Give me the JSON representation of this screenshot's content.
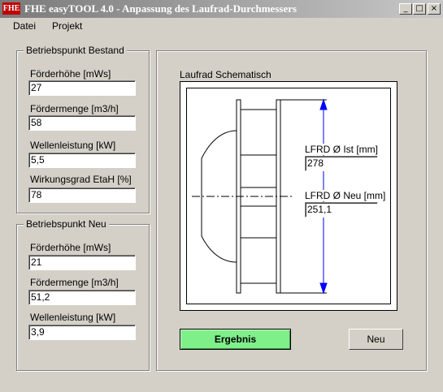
{
  "window": {
    "icon_text": "FHE",
    "title": "FHE easyTOOL 4.0 - Anpassung des Laufrad-Durchmessers",
    "minimize_glyph": "_",
    "maximize_glyph": "□",
    "close_glyph": "×"
  },
  "menu": {
    "items": [
      "Datei",
      "Projekt"
    ]
  },
  "bestand": {
    "title": "Betriebspunkt Bestand",
    "foerderhoehe_label": "Förderhöhe [mWs]",
    "foerderhoehe_value": "27",
    "foerdermenge_label": "Fördermenge [m3/h]",
    "foerdermenge_value": "58",
    "wellenleistung_label": "Wellenleistung [kW]",
    "wellenleistung_value": "5,5",
    "wirkungsgrad_label": "Wirkungsgrad EtaH [%]",
    "wirkungsgrad_value": "78"
  },
  "neu": {
    "title": "Betriebspunkt Neu",
    "foerderhoehe_label": "Förderhöhe [mWs]",
    "foerderhoehe_value": "21",
    "foerdermenge_label": "Fördermenge [m3/h]",
    "foerdermenge_value": "51,2",
    "wellenleistung_label": "Wellenleistung [kW]",
    "wellenleistung_value": "3,9"
  },
  "schema": {
    "title": "Laufrad Schematisch",
    "lfrd_ist_label": "LFRD Ø Ist [mm]",
    "lfrd_ist_value": "278",
    "lfrd_neu_label": "LFRD Ø Neu [mm]",
    "lfrd_neu_value": "251,1",
    "line_color": "#000000",
    "arrow_color": "#0000ff"
  },
  "buttons": {
    "ergebnis": "Ergebnis",
    "neu": "Neu"
  }
}
